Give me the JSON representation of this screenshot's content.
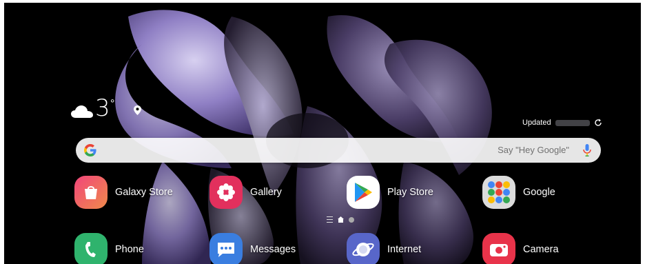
{
  "weather": {
    "temperature": "3",
    "degree": "°",
    "updated_label": "Updated",
    "icon": "cloud-icon",
    "location_icon": "location-pin-icon",
    "refresh_icon": "refresh-icon"
  },
  "search": {
    "placeholder": "Say \"Hey Google\"",
    "logo": "google-g-icon",
    "mic_icon": "mic-icon"
  },
  "apps_row1": [
    {
      "label": "Galaxy Store",
      "icon": "galaxy-store-icon",
      "color": "#e84a7f"
    },
    {
      "label": "Gallery",
      "icon": "gallery-icon",
      "color": "#e2305d"
    },
    {
      "label": "Play Store",
      "icon": "play-store-icon",
      "color": "#ffffff"
    },
    {
      "label": "Google",
      "icon": "google-folder-icon",
      "color": "#d9d9d9"
    }
  ],
  "apps_row2": [
    {
      "label": "Phone",
      "icon": "phone-icon",
      "color": "#2fb36d"
    },
    {
      "label": "Messages",
      "icon": "messages-icon",
      "color": "#3a7ee0"
    },
    {
      "label": "Internet",
      "icon": "internet-icon",
      "color": "#5866c9"
    },
    {
      "label": "Camera",
      "icon": "camera-icon",
      "color": "#e8334a"
    }
  ],
  "pager": {
    "pages": 2,
    "current": 1
  }
}
